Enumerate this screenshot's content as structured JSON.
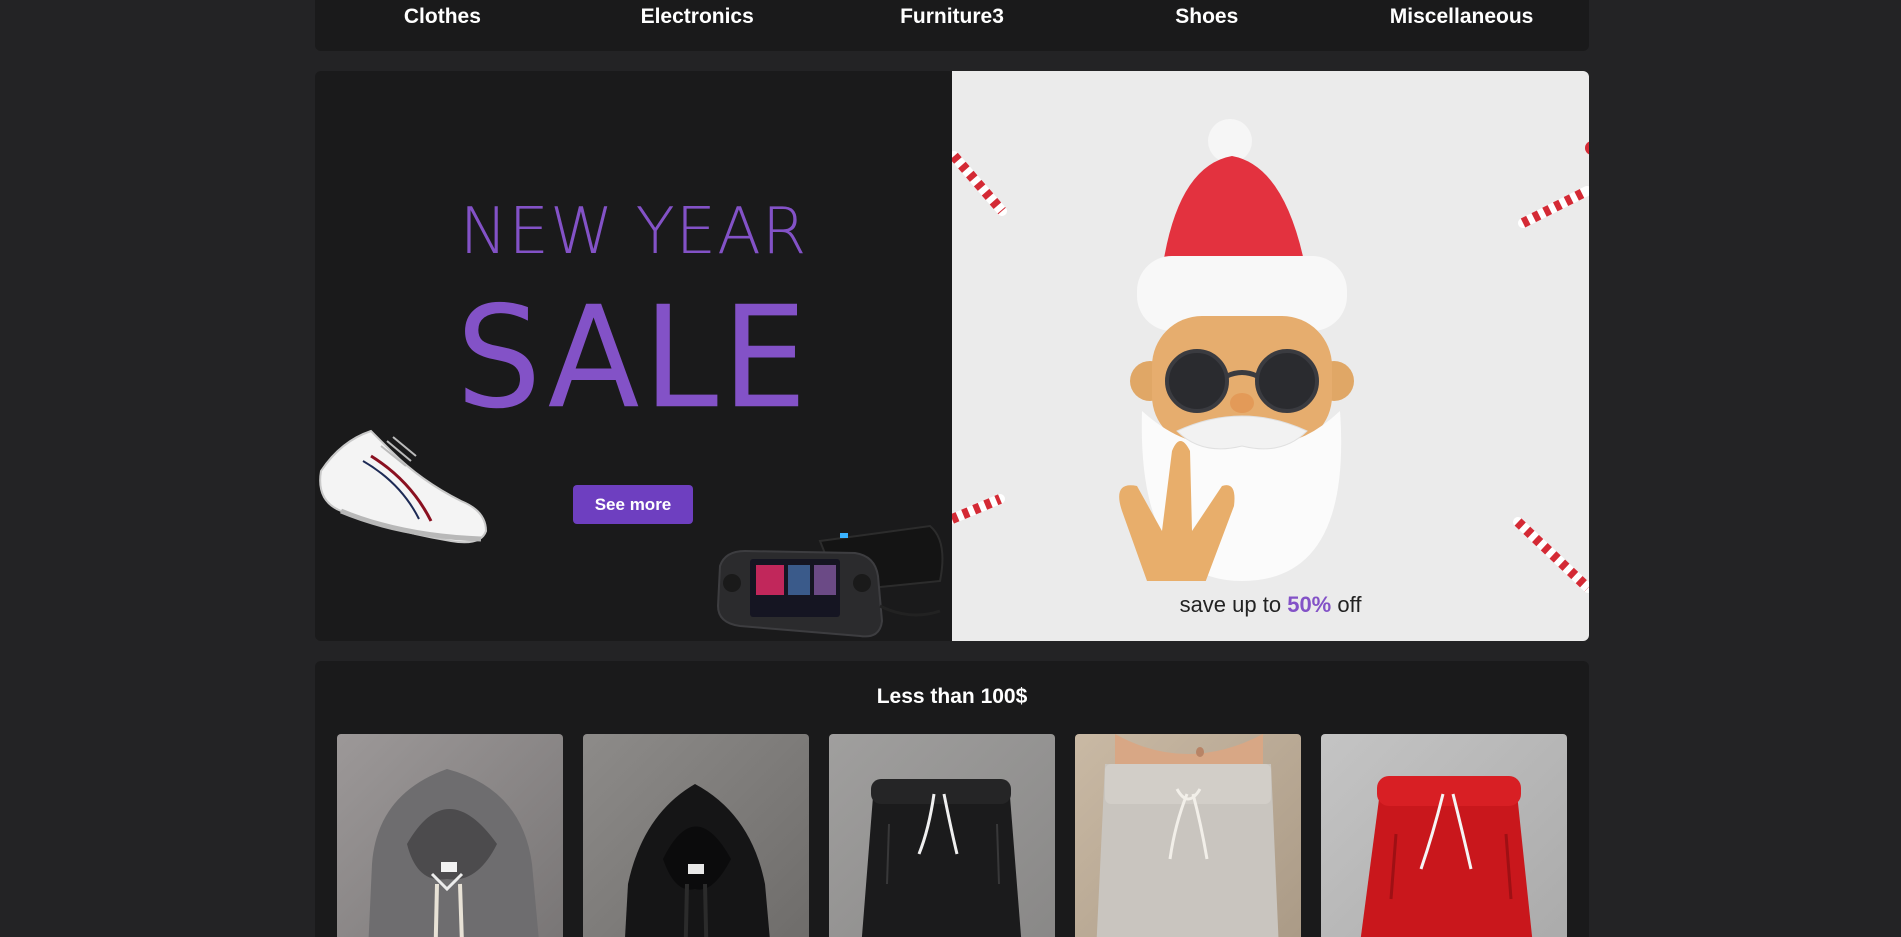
{
  "nav": {
    "categories": [
      "Clothes",
      "Electronics",
      "Furniture3",
      "Shoes",
      "Miscellaneous"
    ]
  },
  "banner": {
    "headline_1": "NEW YEAR",
    "headline_2": "SALE",
    "cta_label": "See more",
    "promo_prefix": "save up to ",
    "promo_percent": "50%",
    "promo_suffix": " off",
    "accent_color": "#8352c7",
    "button_color": "#6e3fc0"
  },
  "section": {
    "title": "Less than 100$",
    "products": [
      {
        "image": "grey-hoodie"
      },
      {
        "image": "black-hoodie"
      },
      {
        "image": "black-shorts"
      },
      {
        "image": "beige-sweatpants"
      },
      {
        "image": "red-shorts"
      }
    ]
  }
}
